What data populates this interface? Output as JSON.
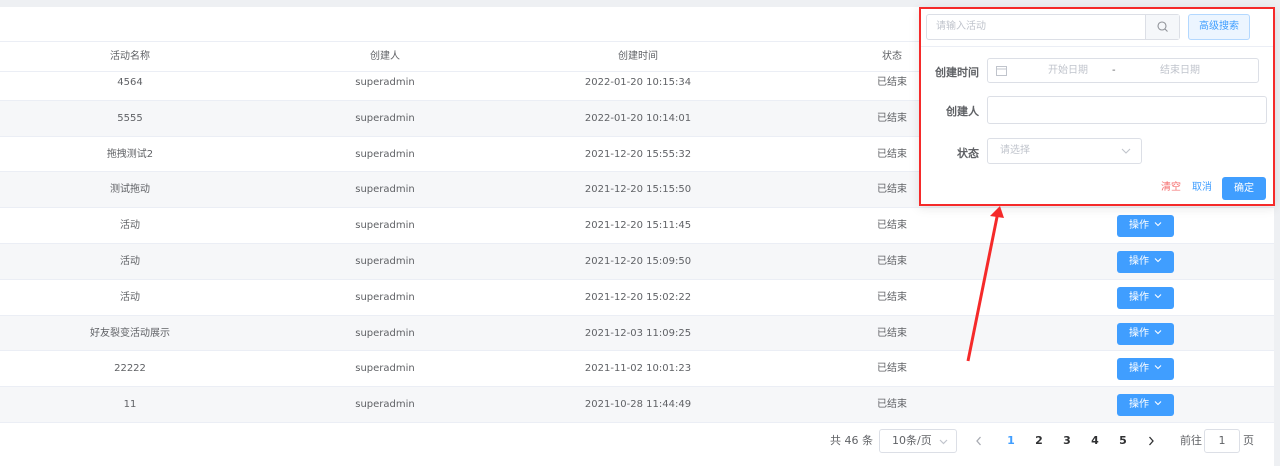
{
  "table": {
    "headers": [
      "活动名称",
      "创建人",
      "创建时间",
      "状态"
    ],
    "rows": [
      {
        "name": "4564",
        "creator": "superadmin",
        "time": "2022-01-20 10:15:34",
        "status": "已结束"
      },
      {
        "name": "5555",
        "creator": "superadmin",
        "time": "2022-01-20 10:14:01",
        "status": "已结束"
      },
      {
        "name": "拖拽测试2",
        "creator": "superadmin",
        "time": "2021-12-20 15:55:32",
        "status": "已结束"
      },
      {
        "name": "测试拖动",
        "creator": "superadmin",
        "time": "2021-12-20 15:15:50",
        "status": "已结束"
      },
      {
        "name": "活动",
        "creator": "superadmin",
        "time": "2021-12-20 15:11:45",
        "status": "已结束",
        "action": "操作"
      },
      {
        "name": "活动",
        "creator": "superadmin",
        "time": "2021-12-20 15:09:50",
        "status": "已结束",
        "action": "操作"
      },
      {
        "name": "活动",
        "creator": "superadmin",
        "time": "2021-12-20 15:02:22",
        "status": "已结束",
        "action": "操作"
      },
      {
        "name": "好友裂变活动展示",
        "creator": "superadmin",
        "time": "2021-12-03 11:09:25",
        "status": "已结束",
        "action": "操作"
      },
      {
        "name": "22222",
        "creator": "superadmin",
        "time": "2021-11-02 10:01:23",
        "status": "已结束",
        "action": "操作"
      },
      {
        "name": "11",
        "creator": "superadmin",
        "time": "2021-10-28 11:44:49",
        "status": "已结束",
        "action": "操作"
      }
    ]
  },
  "pagination": {
    "total": "共 46 条",
    "page_size": "10条/页",
    "pages": [
      "1",
      "2",
      "3",
      "4",
      "5"
    ],
    "current_page": "1",
    "goto_prefix": "前往",
    "goto_value": "1",
    "goto_suffix": "页"
  },
  "search_panel": {
    "search_placeholder": "请输入活动",
    "advanced_label": "高级搜索",
    "created_time_label": "创建时间",
    "start_date_placeholder": "开始日期",
    "range_separator": "-",
    "end_date_placeholder": "结束日期",
    "creator_label": "创建人",
    "creator_value": "",
    "status_label": "状态",
    "status_placeholder": "请选择",
    "clear_label": "清空",
    "cancel_label": "取消",
    "confirm_label": "确定"
  },
  "colors": {
    "primary": "#409eff",
    "highlight_border": "#f52a2a",
    "danger_text": "#f56c6c"
  },
  "icons": {
    "search": "search-icon",
    "calendar": "calendar-icon",
    "chevron": "chevron-down-icon",
    "prev": "chevron-left-icon",
    "next": "chevron-right-icon"
  }
}
